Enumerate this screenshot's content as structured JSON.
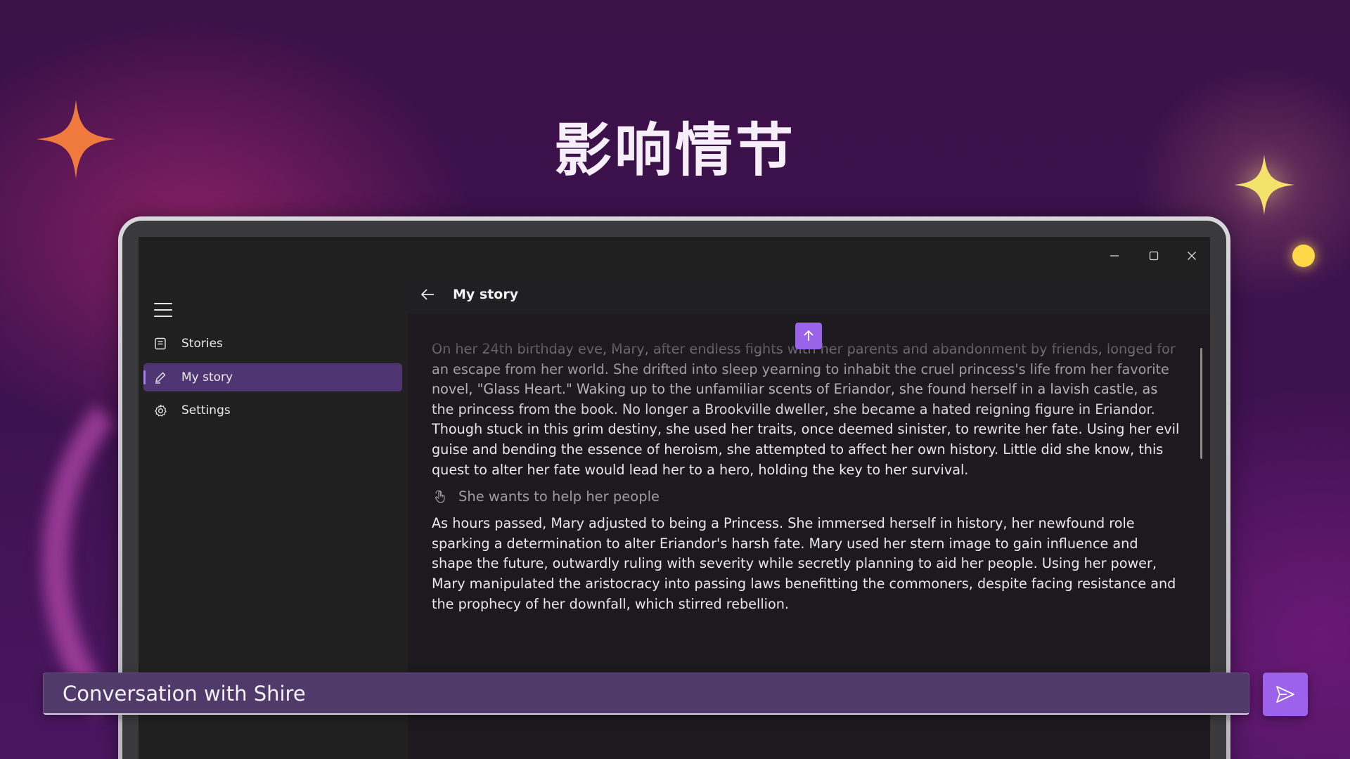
{
  "hero": {
    "title": "影响情节"
  },
  "window": {
    "controls": {
      "minimize": "minimize-icon",
      "maximize": "maximize-icon",
      "close": "close-icon"
    }
  },
  "sidebar": {
    "menu_icon": "hamburger-icon",
    "items": [
      {
        "label": "Stories",
        "icon": "book-icon",
        "selected": false
      },
      {
        "label": "My story",
        "icon": "pen-icon",
        "selected": true
      },
      {
        "label": "Settings",
        "icon": "gear-icon",
        "selected": false
      }
    ]
  },
  "content": {
    "back_icon": "arrow-left-icon",
    "title": "My story",
    "scroll_up_icon": "arrow-up-icon",
    "paragraph_1": "On her 24th birthday eve, Mary, after endless fights with her parents and abandonment by friends, longed for an escape from her world. She drifted into sleep yearning to inhabit the cruel princess's life from her favorite novel, \"Glass Heart.\" Waking up to the unfamiliar scents of Eriandor, she found herself in a lavish castle, as the princess from the book. No longer a Brookville dweller, she became a hated reigning figure in Eriandor. Though stuck in this grim destiny, she used her traits, once deemed sinister, to rewrite her fate. Using her evil guise and bending the essence of heroism, she attempted to affect her own history. Little did she know, this quest to alter her fate would lead her to a hero, holding the key to her survival.",
    "prompt": {
      "icon": "hand-pointer-icon",
      "text": "She wants to help her people"
    },
    "paragraph_2": "As hours passed, Mary adjusted to being a Princess. She immersed herself in history, her newfound role sparking a determination to alter Eriandor's harsh fate. Mary used her stern image to gain influence and shape the future, outwardly ruling with severity while secretly planning to aid her people. Using her power, Mary manipulated the aristocracy into passing laws benefitting the commoners, despite facing resistance and the prophecy of her downfall, which stirred rebellion."
  },
  "chat": {
    "value": "Conversation with Shire",
    "send_icon": "send-icon"
  },
  "colors": {
    "accent": "#9d62ec",
    "selected_nav": "#4f3673",
    "background": "#3e1250"
  }
}
